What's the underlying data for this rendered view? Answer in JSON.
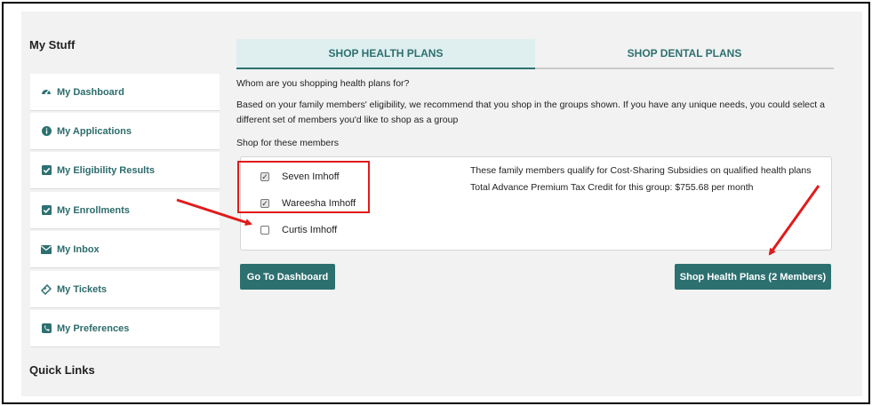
{
  "sidebar": {
    "title": "My Stuff",
    "items": [
      {
        "label": "My Dashboard",
        "icon": "dashboard-icon"
      },
      {
        "label": "My Applications",
        "icon": "info-icon"
      },
      {
        "label": "My Eligibility Results",
        "icon": "checkbox-icon"
      },
      {
        "label": "My Enrollments",
        "icon": "checkbox-icon"
      },
      {
        "label": "My Inbox",
        "icon": "envelope-icon"
      },
      {
        "label": "My Tickets",
        "icon": "ticket-icon"
      },
      {
        "label": "My Preferences",
        "icon": "phone-icon"
      }
    ],
    "quick_links_title": "Quick Links"
  },
  "tabs": [
    {
      "label": "SHOP HEALTH PLANS",
      "active": true
    },
    {
      "label": "SHOP DENTAL PLANS",
      "active": false
    }
  ],
  "main": {
    "question": "Whom are you shopping health plans for?",
    "recommendation_line1": "Based on your family members' eligibility, we recommend that you shop in the groups shown. If you have any unique needs, you could select a",
    "recommendation_line2": "different set of members you'd like to shop as a group",
    "members_heading": "Shop for these members",
    "members": [
      {
        "name": "Seven Imhoff",
        "checked": true
      },
      {
        "name": "Wareesha Imhoff",
        "checked": true
      },
      {
        "name": "Curtis Imhoff",
        "checked": false
      }
    ],
    "subsidy_info": "These family members qualify for Cost-Sharing Subsidies on qualified health plans",
    "tax_credit_info": "Total Advance Premium Tax Credit for this group: $755.68 per month"
  },
  "buttons": {
    "dashboard": "Go To Dashboard",
    "shop": "Shop Health Plans (2 Members)"
  },
  "colors": {
    "accent": "#2d7070",
    "annotation": "#e01b1b",
    "tab_active_bg": "#dfeff0"
  }
}
